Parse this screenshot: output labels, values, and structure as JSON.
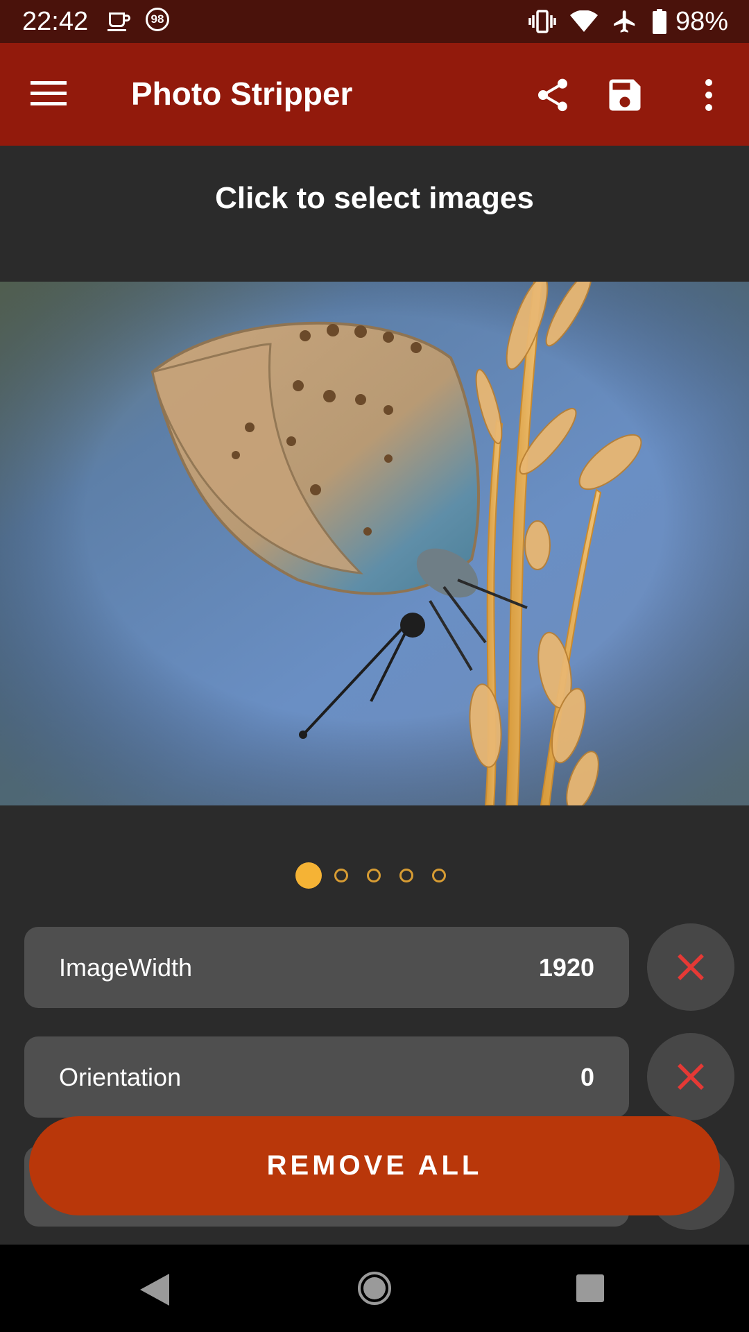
{
  "status_bar": {
    "time": "22:42",
    "notification_badge": "98",
    "battery_percent": "98%",
    "icons": [
      "coffee-cup-icon",
      "vibrate-icon",
      "wifi-icon",
      "airplane-icon",
      "battery-icon"
    ]
  },
  "app_bar": {
    "title": "Photo Stripper",
    "background_color": "#921a0c",
    "icons": [
      "menu-icon",
      "share-icon",
      "save-icon",
      "more-vert-icon"
    ]
  },
  "main": {
    "select_prompt": "Click to select images",
    "image_pager": {
      "current_page": 1,
      "page_count": 5,
      "active_color": "#f5b335"
    },
    "metadata": [
      {
        "key": "ImageWidth",
        "value": "1920"
      },
      {
        "key": "Orientation",
        "value": "0"
      }
    ],
    "remove_all_label": "REMOVE ALL",
    "accent_color": "#b9370a",
    "delete_icon_color": "#e53935"
  },
  "nav_bar": {
    "icons": [
      "back-icon",
      "home-icon",
      "recents-icon"
    ]
  }
}
